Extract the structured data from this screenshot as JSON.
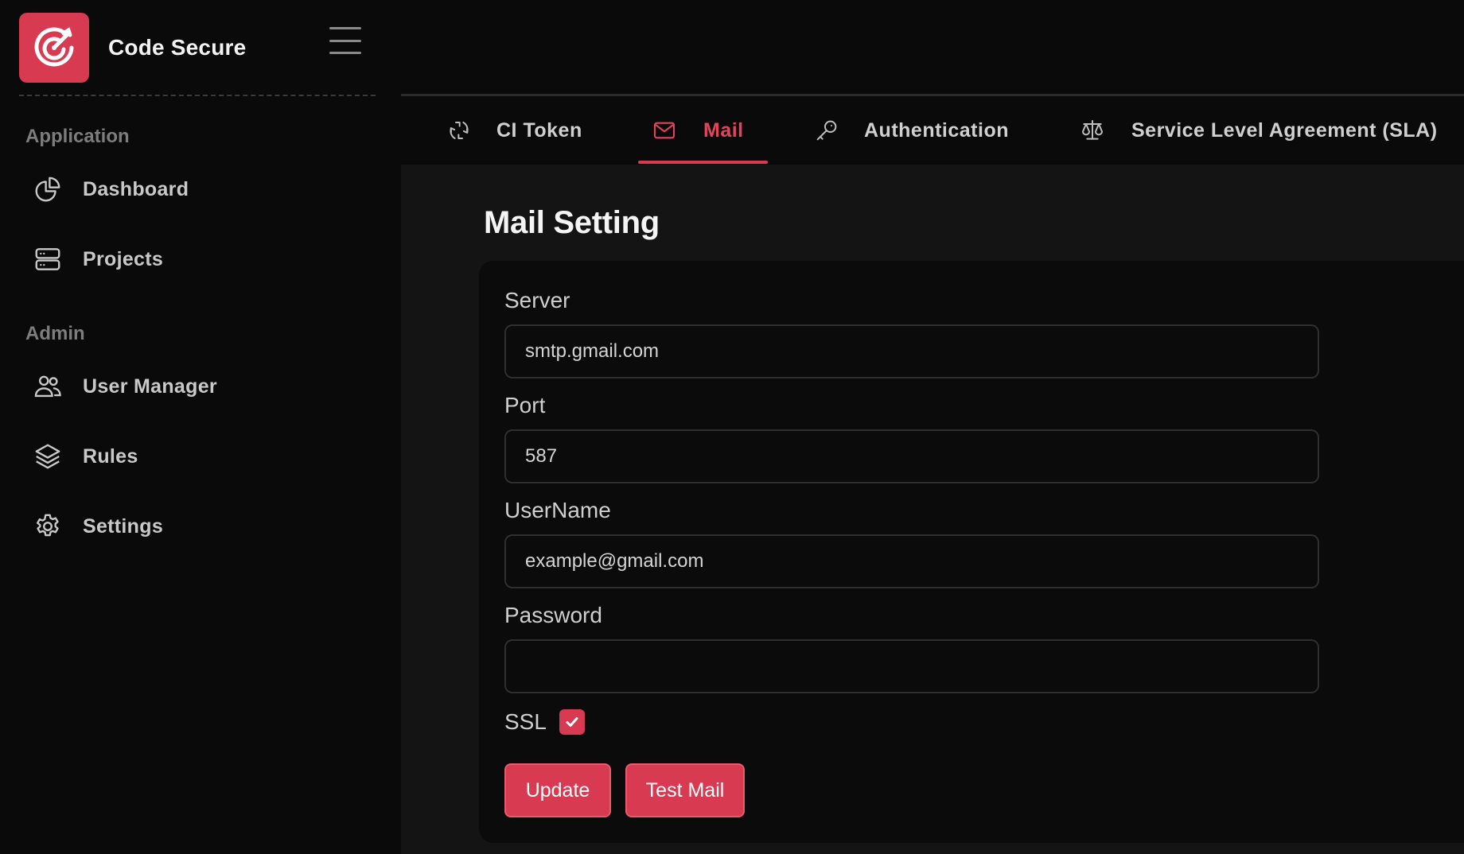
{
  "brand": {
    "name": "Code Secure"
  },
  "sidebar": {
    "sections": [
      {
        "label": "Application",
        "items": [
          {
            "label": "Dashboard",
            "icon": "pie-chart-icon"
          },
          {
            "label": "Projects",
            "icon": "server-icon"
          }
        ]
      },
      {
        "label": "Admin",
        "items": [
          {
            "label": "User Manager",
            "icon": "users-icon"
          },
          {
            "label": "Rules",
            "icon": "layers-icon"
          },
          {
            "label": "Settings",
            "icon": "gear-icon"
          }
        ]
      }
    ]
  },
  "tabs": [
    {
      "label": "CI Token",
      "icon": "refresh-icon",
      "active": false
    },
    {
      "label": "Mail",
      "icon": "mail-icon",
      "active": true
    },
    {
      "label": "Authentication",
      "icon": "key-icon",
      "active": false
    },
    {
      "label": "Service Level Agreement (SLA)",
      "icon": "scale-icon",
      "active": false
    }
  ],
  "mail_setting": {
    "title": "Mail Setting",
    "fields": {
      "server": {
        "label": "Server",
        "value": "smtp.gmail.com"
      },
      "port": {
        "label": "Port",
        "value": "587"
      },
      "username": {
        "label": "UserName",
        "value": "example@gmail.com"
      },
      "password": {
        "label": "Password",
        "value": ""
      }
    },
    "ssl": {
      "label": "SSL",
      "checked": true
    },
    "buttons": {
      "update": "Update",
      "test_mail": "Test Mail"
    }
  },
  "colors": {
    "accent": "#d73a51",
    "background": "#0a0a0b",
    "content_bg": "#141415"
  }
}
